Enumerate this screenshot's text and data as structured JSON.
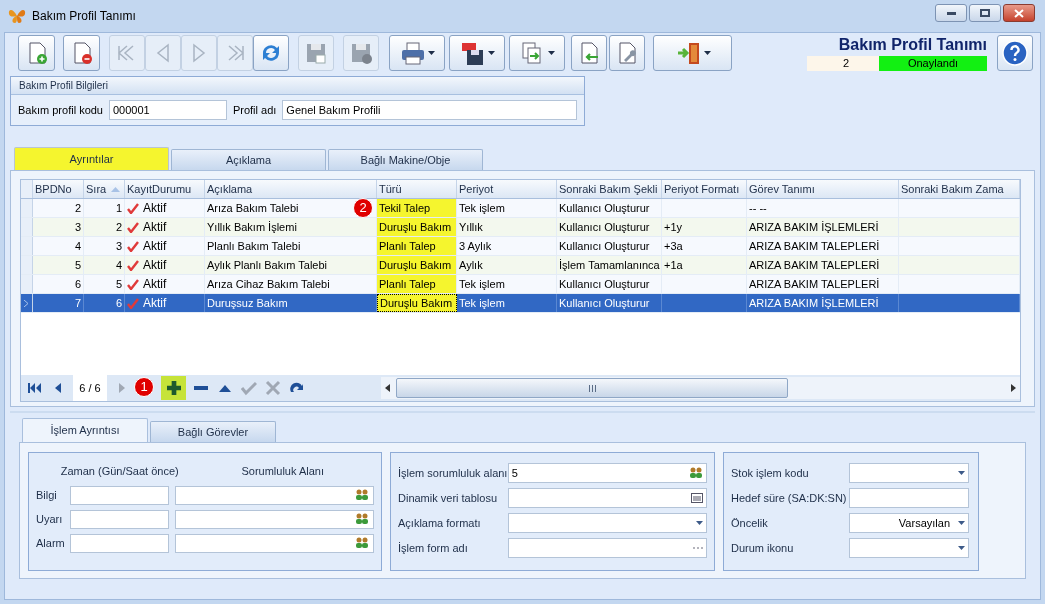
{
  "window": {
    "title": "Bakım Profil Tanımı"
  },
  "header": {
    "title": "Bakım Profil Tanımı",
    "number": "2",
    "status": "Onaylandı"
  },
  "toolbar": [
    {
      "kind": "new",
      "disabled": false,
      "dropdown": false
    },
    {
      "kind": "delete",
      "disabled": false,
      "dropdown": false
    },
    {
      "kind": "first",
      "disabled": true,
      "dropdown": false
    },
    {
      "kind": "prev",
      "disabled": true,
      "dropdown": false
    },
    {
      "kind": "next",
      "disabled": true,
      "dropdown": false
    },
    {
      "kind": "last",
      "disabled": true,
      "dropdown": false
    },
    {
      "kind": "refresh",
      "disabled": false,
      "dropdown": false
    },
    {
      "kind": "save",
      "disabled": true,
      "dropdown": false
    },
    {
      "kind": "discard",
      "disabled": true,
      "dropdown": false
    },
    {
      "kind": "print",
      "disabled": false,
      "dropdown": true
    },
    {
      "kind": "pdf",
      "disabled": false,
      "dropdown": true
    },
    {
      "kind": "export",
      "disabled": false,
      "dropdown": true
    },
    {
      "kind": "import",
      "disabled": false,
      "dropdown": false
    },
    {
      "kind": "tools",
      "disabled": false,
      "dropdown": false
    },
    {
      "kind": "exit",
      "disabled": false,
      "dropdown": true
    }
  ],
  "info_group": {
    "title": "Bakım Profil Bilgileri",
    "fields": [
      {
        "label": "Bakım profil kodu",
        "value": "000001"
      },
      {
        "label": "Profil adı",
        "value": "Genel Bakım Profili"
      }
    ]
  },
  "tabs": [
    {
      "label": "Ayrıntılar",
      "selected": true
    },
    {
      "label": "Açıklama",
      "selected": false
    },
    {
      "label": "Bağlı Makine/Obje",
      "selected": false
    }
  ],
  "grid": {
    "badge": "2",
    "columns": [
      {
        "label": "BPDNo",
        "sort_ascending": false
      },
      {
        "label": "Sıra",
        "sort_ascending": true
      },
      {
        "label": "KayıtDurumu",
        "sort_ascending": false
      },
      {
        "label": "Açıklama",
        "sort_ascending": false
      },
      {
        "label": "Türü",
        "sort_ascending": false
      },
      {
        "label": "Periyot",
        "sort_ascending": false
      },
      {
        "label": "Sonraki Bakım Şekli",
        "sort_ascending": false
      },
      {
        "label": "Periyot Formatı",
        "sort_ascending": false
      },
      {
        "label": "Görev Tanımı",
        "sort_ascending": false
      },
      {
        "label": "Sonraki Bakım Zama",
        "sort_ascending": false
      }
    ],
    "rows": [
      {
        "selected": false,
        "bpdno": "2",
        "sira": "1",
        "status": "Aktif",
        "aciklama": "Arıza Bakım Talebi",
        "turu": "Tekil Talep",
        "periyot": "Tek işlem",
        "sonraki": "Kullanıcı Oluşturur",
        "gorev": "-- --"
      },
      {
        "selected": false,
        "bpdno": "3",
        "sira": "2",
        "status": "Aktif",
        "aciklama": "Yıllık Bakım İşlemi",
        "turu": "Duruşlu Bakım",
        "periyot": "Yıllık",
        "sonraki": "Kullanıcı Oluşturur",
        "format": "+1y",
        "gorev": "ARIZA BAKIM İŞLEMLERİ"
      },
      {
        "selected": false,
        "bpdno": "4",
        "sira": "3",
        "status": "Aktif",
        "aciklama": "Planlı Bakım Talebi",
        "turu": "Planlı Talep",
        "periyot": "3 Aylık",
        "sonraki": "Kullanıcı Oluşturur",
        "format": "+3a",
        "gorev": "ARIZA BAKIM TALEPLERİ"
      },
      {
        "selected": false,
        "bpdno": "5",
        "sira": "4",
        "status": "Aktif",
        "aciklama": "Aylık Planlı Bakım Talebi",
        "turu": "Duruşlu Bakım",
        "periyot": "Aylık",
        "sonraki": "İşlem Tamamlanınca",
        "format": "+1a",
        "gorev": "ARIZA BAKIM TALEPLERİ"
      },
      {
        "selected": false,
        "bpdno": "6",
        "sira": "5",
        "status": "Aktif",
        "aciklama": "Arıza Cihaz Bakım Talebi",
        "turu": "Planlı Talep",
        "periyot": "Tek işlem",
        "sonraki": "Kullanıcı Oluşturur",
        "gorev": "ARIZA BAKIM TALEPLERİ"
      },
      {
        "selected": true,
        "bpdno": "7",
        "sira": "6",
        "status": "Aktif",
        "aciklama": "Duruşsuz Bakım",
        "turu": "Duruşlu Bakım",
        "periyot": "Tek işlem",
        "sonraki": "Kullanıcı Oluşturur",
        "gorev": "ARIZA BAKIM İŞLEMLERİ"
      }
    ]
  },
  "navigator": {
    "position": "6 / 6",
    "badge": "1",
    "buttons": [
      {
        "kind": "first",
        "disabled": false,
        "highlighted": false
      },
      {
        "kind": "prev",
        "disabled": false,
        "highlighted": false
      },
      {
        "kind": "next",
        "disabled": true,
        "highlighted": false
      },
      {
        "kind": "add",
        "disabled": false,
        "highlighted": true
      },
      {
        "kind": "remove",
        "disabled": false,
        "highlighted": false
      },
      {
        "kind": "up",
        "disabled": false,
        "highlighted": false
      },
      {
        "kind": "apply",
        "disabled": true,
        "highlighted": false
      },
      {
        "kind": "cancel",
        "disabled": true,
        "highlighted": false
      },
      {
        "kind": "refresh",
        "disabled": false,
        "highlighted": false
      }
    ]
  },
  "bottom_tabs": [
    {
      "label": "İşlem Ayrıntısı",
      "selected": true
    },
    {
      "label": "Bağlı Görevler",
      "selected": false
    }
  ],
  "timing_group": {
    "headers": [
      "Zaman (Gün/Saat önce)",
      "Sorumluluk Alanı"
    ],
    "rows": [
      {
        "label": "Bilgi"
      },
      {
        "label": "Uyarı"
      },
      {
        "label": "Alarm"
      }
    ]
  },
  "process_group": [
    {
      "label": "İşlem sorumluluk alanı",
      "value": "5",
      "kind": "people"
    },
    {
      "label": "Dinamik veri tablosu",
      "kind": "table"
    },
    {
      "label": "Açıklama formatı",
      "kind": "dropdown"
    },
    {
      "label": "İşlem form adı",
      "kind": "ellipsis"
    }
  ],
  "stock_group": [
    {
      "label": "Stok işlem kodu",
      "kind": "dropdown"
    },
    {
      "label": "Hedef süre (SA:DK:SN)",
      "kind": "text"
    },
    {
      "label": "Öncelik",
      "value": "Varsayılan",
      "kind": "dropdown"
    },
    {
      "label": "Durum ikonu",
      "kind": "dropdown"
    }
  ]
}
